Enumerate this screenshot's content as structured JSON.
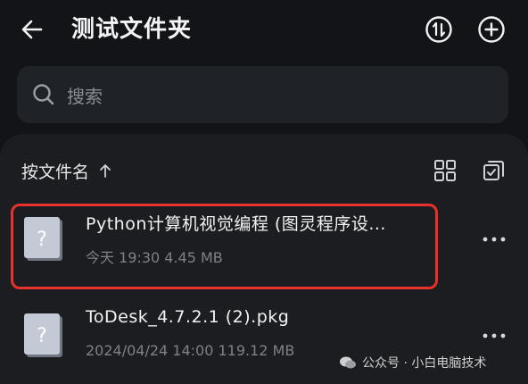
{
  "header": {
    "title": "测试文件夹",
    "back_icon": "arrow-left-icon",
    "switch_icon": "swap-vertical-icon",
    "add_icon": "plus-circle-icon"
  },
  "search": {
    "placeholder": "搜索",
    "icon": "search-icon"
  },
  "sort": {
    "label": "按文件名",
    "direction_icon": "arrow-up-icon"
  },
  "toolbar": {
    "grid_icon": "grid-view-icon",
    "select_icon": "multi-select-icon"
  },
  "files": [
    {
      "name": "Python计算机视觉编程 (图灵程序设...",
      "meta": "今天 19:30   4.45 MB",
      "icon": "unknown-file-icon"
    },
    {
      "name": "ToDesk_4.7.2.1 (2).pkg",
      "meta": "2024/04/24 14:00   119.12 MB",
      "icon": "unknown-file-icon"
    }
  ],
  "watermark": {
    "text": "公众号 · 小白电脑技术"
  },
  "colors": {
    "background": "#121417",
    "panel": "#1b1d21",
    "search_bg": "#1f2227",
    "highlight": "#e8312a"
  }
}
